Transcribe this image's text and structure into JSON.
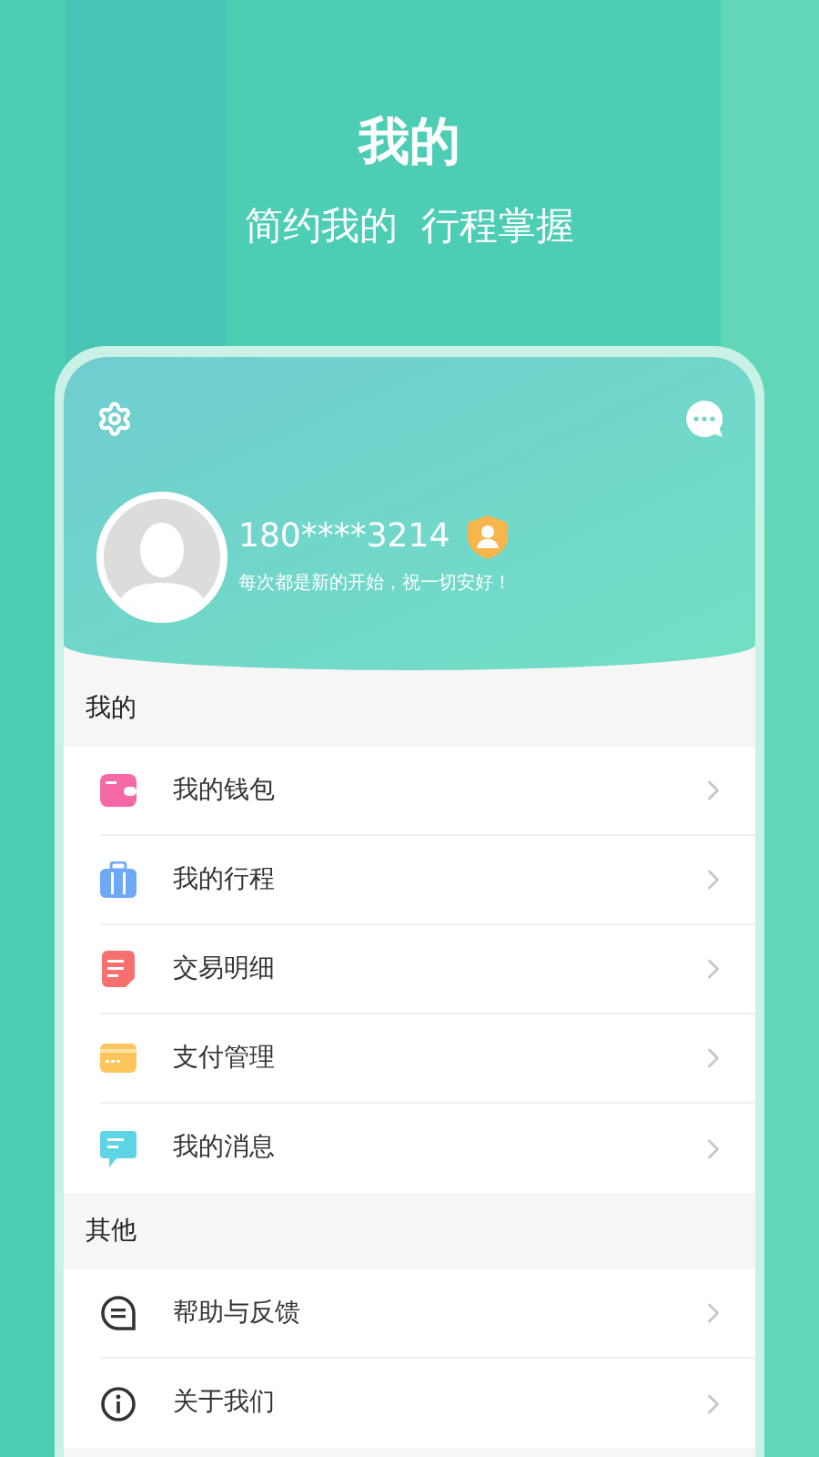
{
  "promo": {
    "title": "我的",
    "subtitle": "简约我的  行程掌握"
  },
  "profile": {
    "phone": "180****3214",
    "motto": "每次都是新的开始，祝一切安好！"
  },
  "sections": [
    {
      "title": "我的",
      "items": [
        {
          "label": "我的钱包",
          "kind": "wallet"
        },
        {
          "label": "我的行程",
          "kind": "suitcase"
        },
        {
          "label": "交易明细",
          "kind": "document"
        },
        {
          "label": "支付管理",
          "kind": "card"
        },
        {
          "label": "我的消息",
          "kind": "message"
        }
      ]
    },
    {
      "title": "其他",
      "items": [
        {
          "label": "帮助与反馈",
          "kind": "help"
        },
        {
          "label": "关于我们",
          "kind": "info"
        }
      ]
    }
  ]
}
